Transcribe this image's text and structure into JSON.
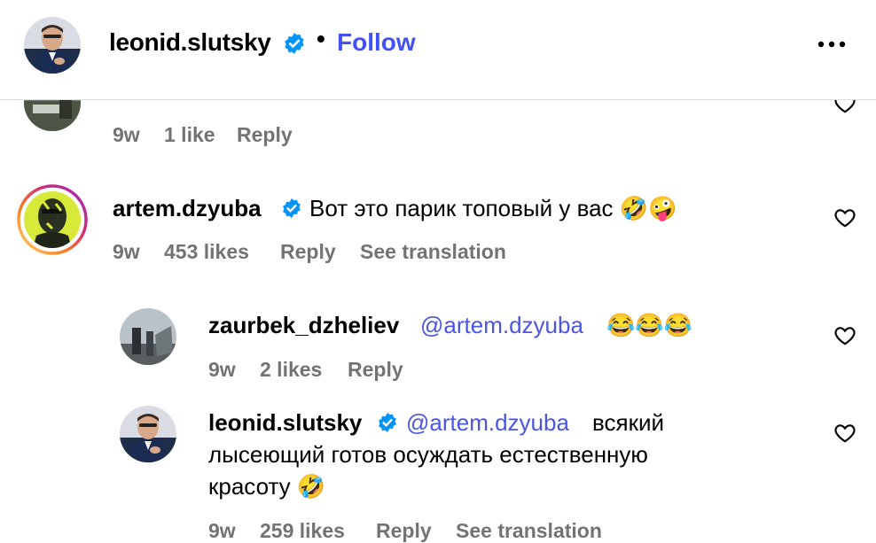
{
  "header": {
    "username": "leonid.slutsky",
    "separator": "•",
    "follow_label": "Follow",
    "more_icon": "more-options-icon"
  },
  "comments": [
    {
      "id": "partial",
      "age": "9w",
      "likes": "1 like",
      "reply": "Reply"
    },
    {
      "id": "dzyuba",
      "username": "artem.dzyuba",
      "text": "Вот это парик топовый у вас 🤣🤪",
      "age": "9w",
      "likes": "453 likes",
      "reply": "Reply",
      "translate": "See translation"
    },
    {
      "id": "zaurbek",
      "username": "zaurbek_dzheliev",
      "mention": "@artem.dzyuba",
      "text": "😂😂😂",
      "age": "9w",
      "likes": "2 likes",
      "reply": "Reply"
    },
    {
      "id": "slutsky",
      "username": "leonid.slutsky",
      "mention": "@artem.dzyuba",
      "text_line1": "всякий",
      "text_line2": "лысеющий готов осуждать естественную",
      "text_line3": "красоту 🤣",
      "age": "9w",
      "likes": "259 likes",
      "reply": "Reply",
      "translate": "See translation"
    }
  ],
  "colors": {
    "accent": "#4150f7",
    "meta_gray": "#737373",
    "verified_blue": "#0095f6"
  }
}
